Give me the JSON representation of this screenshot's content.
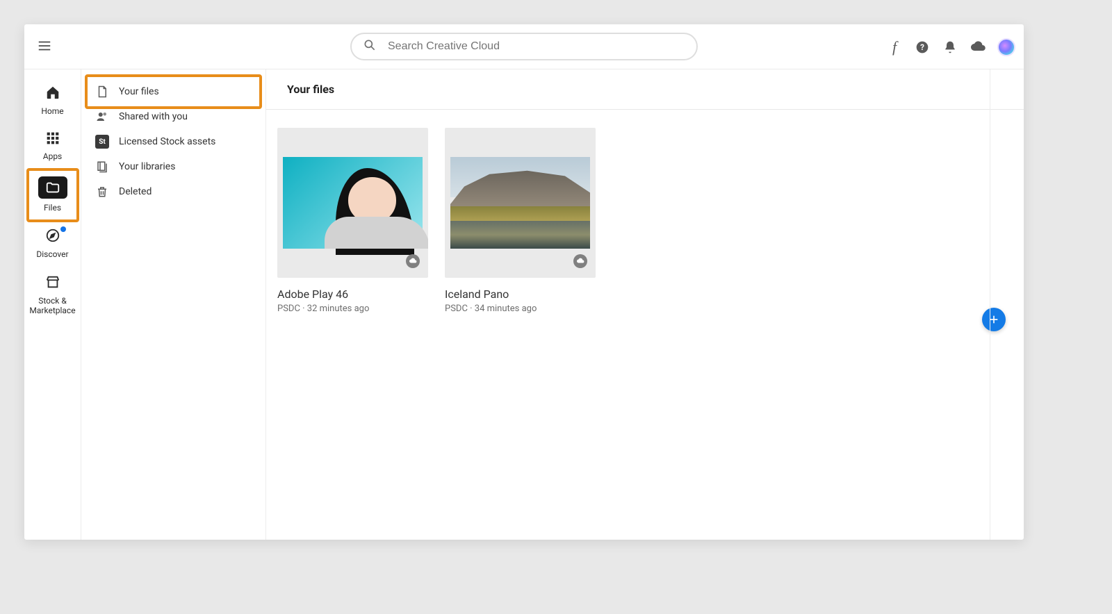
{
  "search": {
    "placeholder": "Search Creative Cloud"
  },
  "rail": {
    "home": {
      "label": "Home"
    },
    "apps": {
      "label": "Apps"
    },
    "files": {
      "label": "Files"
    },
    "discover": {
      "label": "Discover"
    },
    "stock": {
      "label": "Stock & Marketplace"
    }
  },
  "sub": {
    "your_files": "Your files",
    "shared": "Shared with you",
    "licensed": "Licensed Stock assets",
    "libraries": "Your libraries",
    "deleted": "Deleted",
    "st_badge": "St"
  },
  "page_title": "Your files",
  "files": [
    {
      "title": "Adobe Play 46",
      "meta": "PSDC · 32 minutes ago"
    },
    {
      "title": "Iceland Pano",
      "meta": "PSDC · 34 minutes ago"
    }
  ]
}
